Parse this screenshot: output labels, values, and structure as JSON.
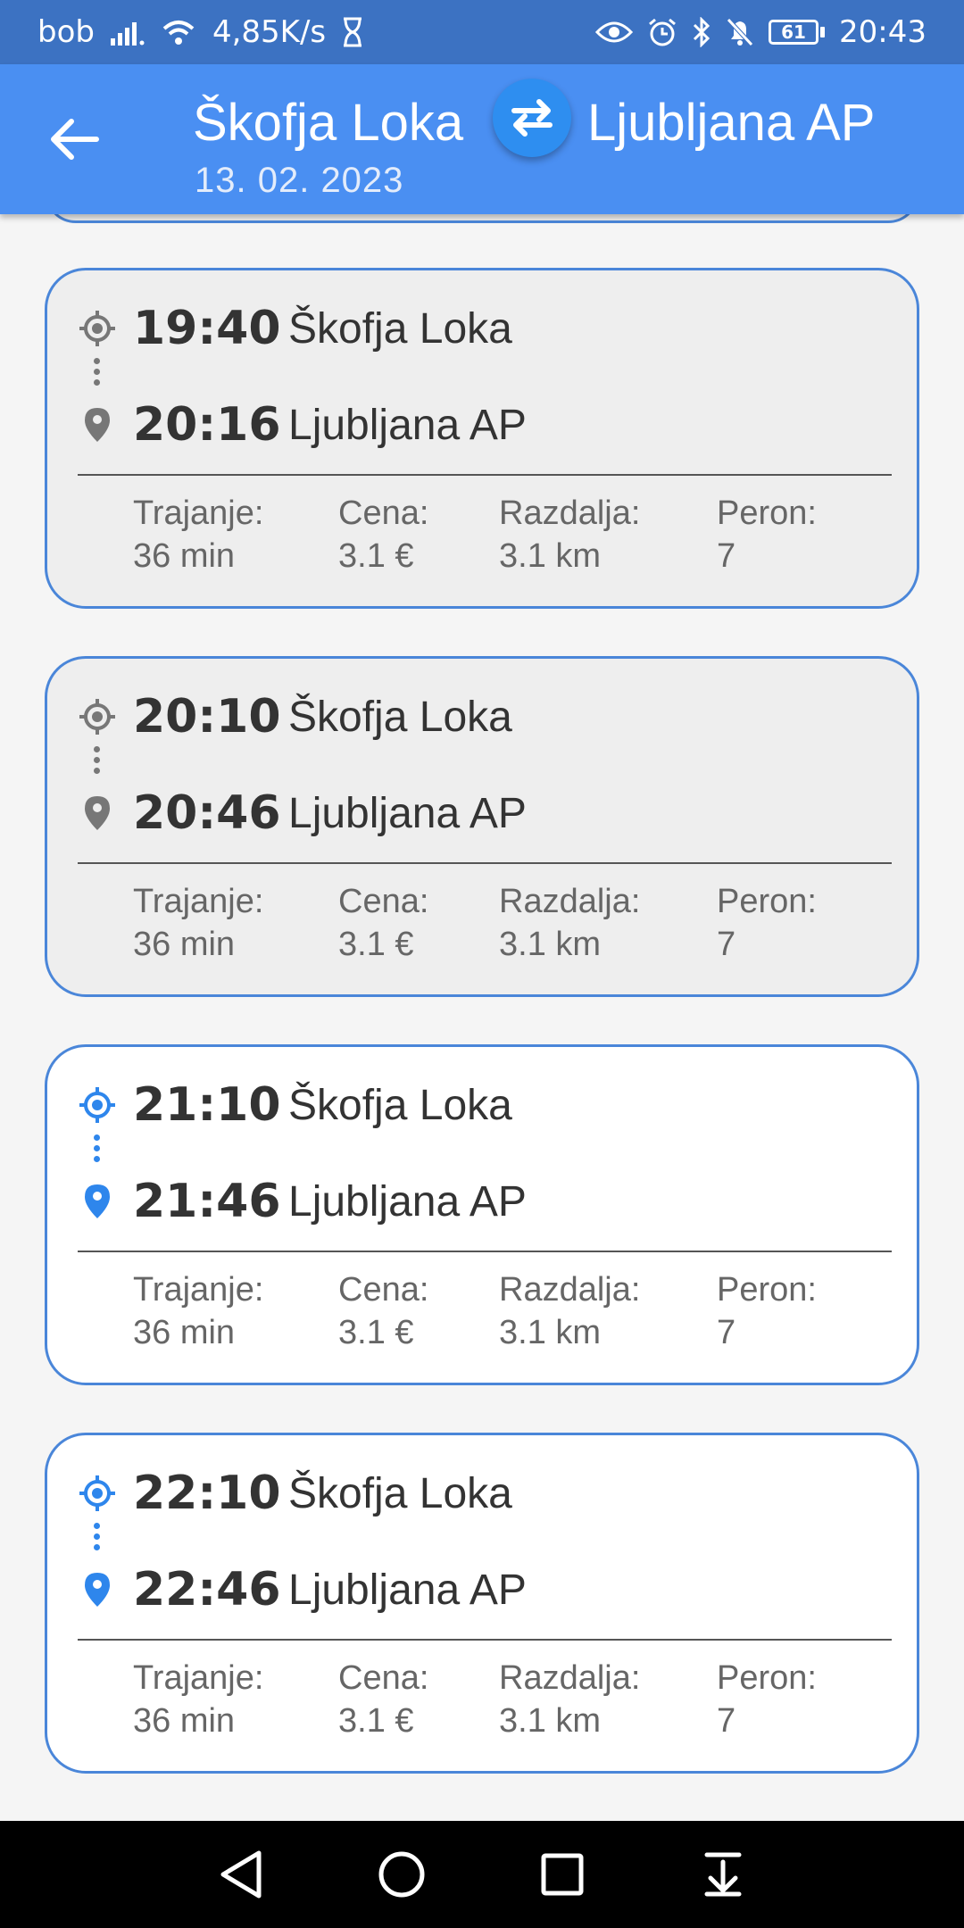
{
  "status_bar": {
    "carrier": "bob",
    "speed": "4,85K/s",
    "battery": "61",
    "time": "20:43"
  },
  "header": {
    "from": "Škofja Loka",
    "to": "Ljubljana AP",
    "date": "13. 02. 2023"
  },
  "labels": {
    "duration": "Trajanje:",
    "price": "Cena:",
    "distance": "Razdalja:",
    "platform": "Peron:"
  },
  "departures": [
    {
      "dep_time": "19:40",
      "dep_place": "Škofja Loka",
      "arr_time": "20:16",
      "arr_place": "Ljubljana AP",
      "duration": "36 min",
      "price": "3.1 €",
      "distance": "3.1 km",
      "platform": "7",
      "state": "past"
    },
    {
      "dep_time": "20:10",
      "dep_place": "Škofja Loka",
      "arr_time": "20:46",
      "arr_place": "Ljubljana AP",
      "duration": "36 min",
      "price": "3.1 €",
      "distance": "3.1 km",
      "platform": "7",
      "state": "past"
    },
    {
      "dep_time": "21:10",
      "dep_place": "Škofja Loka",
      "arr_time": "21:46",
      "arr_place": "Ljubljana AP",
      "duration": "36 min",
      "price": "3.1 €",
      "distance": "3.1 km",
      "platform": "7",
      "state": "upcoming"
    },
    {
      "dep_time": "22:10",
      "dep_place": "Škofja Loka",
      "arr_time": "22:46",
      "arr_place": "Ljubljana AP",
      "duration": "36 min",
      "price": "3.1 €",
      "distance": "3.1 km",
      "platform": "7",
      "state": "upcoming"
    }
  ],
  "colors": {
    "app_bar": "#4a8ff2",
    "status_bar": "#3c72c2",
    "card_border": "#4a86d9",
    "accent_icon": "#2e86ec",
    "past_icon": "#777777"
  },
  "icons": {
    "back": "arrow-left-icon",
    "swap": "swap-arrows-icon",
    "departure": "crosshair-icon",
    "arrival": "location-pin-icon"
  }
}
